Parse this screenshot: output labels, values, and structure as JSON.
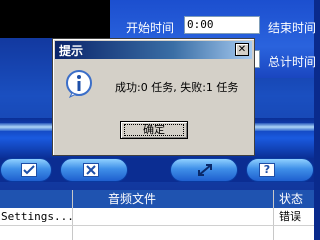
{
  "background_panel": {
    "start_time_label": "开始时间",
    "start_time_value": "0:00",
    "end_time_label": "结束时间",
    "total_time_label": "总计时间"
  },
  "dialog": {
    "title": "提示",
    "close_glyph": "✕",
    "message": "成功:0 任务, 失败:1 任务",
    "ok_label": "确定"
  },
  "toolbar": {
    "icons": [
      "checkbox-icon",
      "cross-icon",
      "convert-icon",
      "help-icon"
    ],
    "help_glyph": "?"
  },
  "file_list": {
    "columns": [
      "音频文件",
      "状态"
    ],
    "rows": [
      {
        "name": "Settings...",
        "status": "错误"
      }
    ]
  },
  "colors": {
    "titlebar_start": "#0a246a",
    "titlebar_end": "#a6caf0",
    "dialog_face": "#d4d0c8",
    "panel_blue": "#1c4fcf"
  }
}
